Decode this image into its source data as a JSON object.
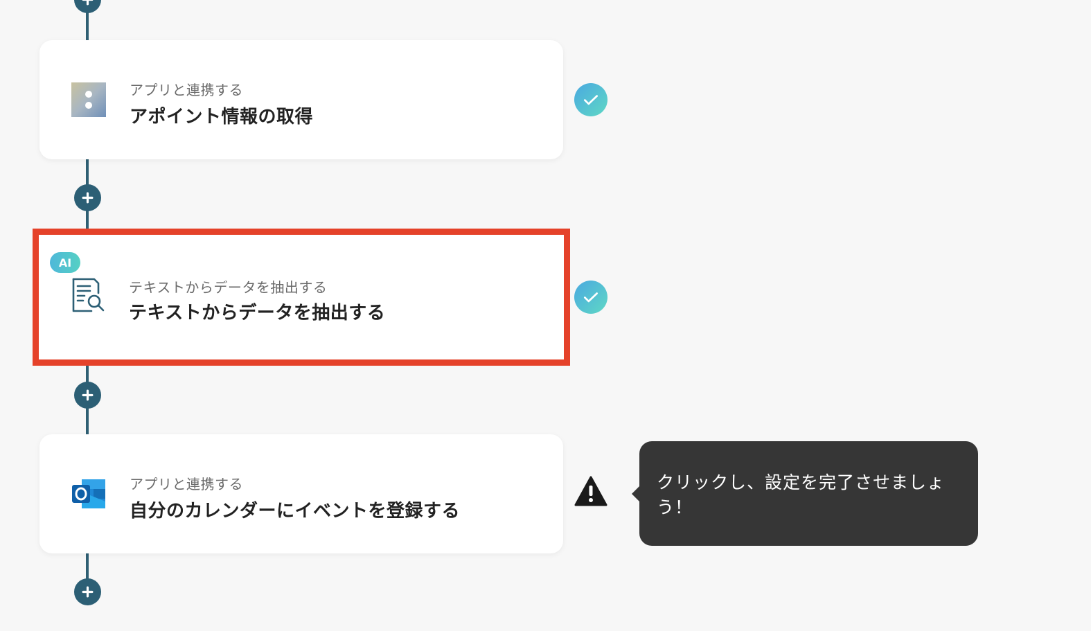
{
  "steps": [
    {
      "subtitle": "アプリと連携する",
      "title": "アポイント情報の取得",
      "icon": "spreadsheet-app-icon",
      "status": "complete"
    },
    {
      "badge": "AI",
      "subtitle": "テキストからデータを抽出する",
      "title": "テキストからデータを抽出する",
      "icon": "document-search-icon",
      "status": "complete",
      "highlighted": true
    },
    {
      "subtitle": "アプリと連携する",
      "title": "自分のカレンダーにイベントを登録する",
      "icon": "outlook-icon",
      "status": "warning"
    }
  ],
  "tooltip": {
    "text": "クリックし、設定を完了させましょう！"
  },
  "colors": {
    "flow_line": "#2f5f73",
    "highlight": "#e5422a",
    "check_gradient": [
      "#4aa9e0",
      "#5fd8c5"
    ],
    "tooltip_bg": "#363636"
  }
}
